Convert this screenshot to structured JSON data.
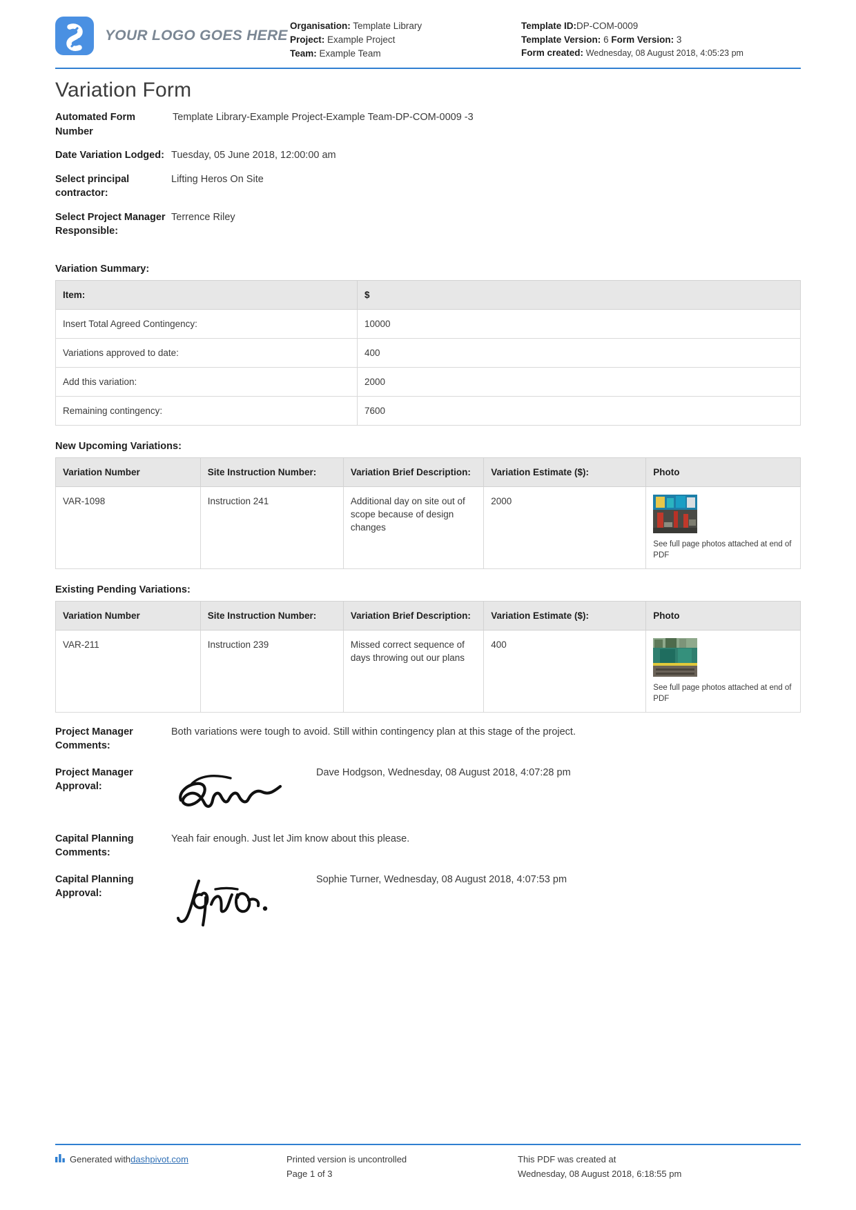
{
  "header": {
    "logo_text": "YOUR LOGO GOES HERE",
    "logo_icon": "dashpivot-logo-icon",
    "accent_color": "#2f7fd1",
    "logo_color": "#4a90e2",
    "left_meta": [
      {
        "label": "Organisation:",
        "value": "Template Library"
      },
      {
        "label": "Project:",
        "value": "Example Project"
      },
      {
        "label": "Team:",
        "value": "Example Team"
      }
    ],
    "right_meta": {
      "template_id_label": "Template ID:",
      "template_id_value": "DP-COM-0009",
      "template_version_label": "Template Version:",
      "template_version_value": "6",
      "form_version_label": "Form Version:",
      "form_version_value": "3",
      "form_created_label": "Form created:",
      "form_created_value": "Wednesday, 08 August 2018, 4:05:23 pm"
    }
  },
  "title": "Variation Form",
  "fields": [
    {
      "label": "Automated Form Number",
      "value": "Template Library-Example Project-Example Team-DP-COM-0009   -3"
    },
    {
      "label": "Date Variation Lodged:",
      "value": "Tuesday, 05 June 2018, 12:00:00 am"
    },
    {
      "label": "Select principal contractor:",
      "value": "Lifting Heros On Site"
    },
    {
      "label": "Select Project Manager Responsible:",
      "value": "Terrence Riley"
    }
  ],
  "summary": {
    "heading": "Variation Summary:",
    "columns": [
      "Item:",
      "$"
    ],
    "rows": [
      [
        "Insert Total Agreed Contingency:",
        "10000"
      ],
      [
        "Variations approved to date:",
        "400"
      ],
      [
        "Add this variation:",
        "2000"
      ],
      [
        "Remaining contingency:",
        "7600"
      ]
    ]
  },
  "new_variations": {
    "heading": "New Upcoming Variations:",
    "columns": [
      "Variation Number",
      "Site Instruction Number:",
      "Variation Brief Description:",
      "Variation Estimate ($):",
      "Photo"
    ],
    "rows": [
      {
        "variation_number": "VAR-1098",
        "site_instruction_number": "Instruction 241",
        "description": "Additional day on site out of scope because of design changes",
        "estimate": "2000",
        "photo_note": "See full page photos attached at end of PDF"
      }
    ]
  },
  "existing_variations": {
    "heading": "Existing Pending Variations:",
    "columns": [
      "Variation Number",
      "Site Instruction Number:",
      "Variation Brief Description:",
      "Variation Estimate ($):",
      "Photo"
    ],
    "rows": [
      {
        "variation_number": "VAR-211",
        "site_instruction_number": "Instruction 239",
        "description": "Missed correct sequence of days throwing out our plans",
        "estimate": "400",
        "photo_note": "See full page photos attached at end of PDF"
      }
    ]
  },
  "approvals": [
    {
      "label": "Project Manager Comments:",
      "text": "Both variations were tough to avoid. Still within contingency plan at this stage of the project."
    },
    {
      "label": "Project Manager Approval:",
      "signer": "Dave Hodgson, Wednesday, 08 August 2018, 4:07:28 pm"
    },
    {
      "label": "Capital Planning Comments:",
      "text": "Yeah fair enough. Just let Jim know about this please."
    },
    {
      "label": "Capital Planning Approval:",
      "signer": "Sophie Turner, Wednesday, 08 August 2018, 4:07:53 pm"
    }
  ],
  "footer": {
    "generated_prefix": "Generated with ",
    "generated_link": "dashpivot.com",
    "uncontrolled": "Printed version is uncontrolled",
    "page_number": "Page 1 of 3",
    "created_label": "This PDF was created at",
    "created_value": "Wednesday, 08 August 2018, 6:18:55 pm"
  }
}
